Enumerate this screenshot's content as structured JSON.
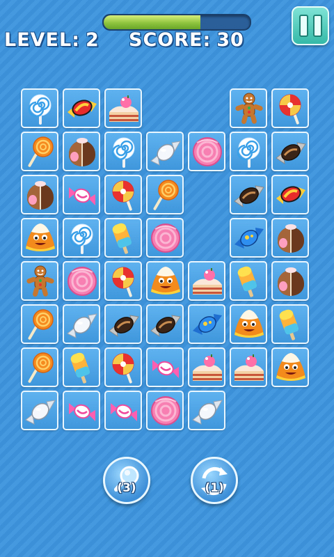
{
  "hud": {
    "level_label": "LEVEL:",
    "level_value": "2",
    "score_label": "SCORE:",
    "score_value": "30",
    "time_progress_fraction": 0.66
  },
  "board": {
    "columns": 7,
    "rows": 8,
    "grid": [
      [
        "swirl-lollipop",
        "wrapped-candy-red",
        "cake-slice",
        null,
        null,
        "gingerbread-man",
        "peppermint-lollipop"
      ],
      [
        "orange-lollipop",
        "chocolate-truffle",
        "swirl-lollipop",
        "wrapped-candy-silver",
        "pink-cupcake",
        "swirl-lollipop",
        "wrapped-candy-chocolate"
      ],
      [
        "chocolate-truffle",
        "wrapped-candy-pink",
        "peppermint-lollipop",
        "orange-lollipop",
        null,
        "wrapped-candy-chocolate",
        "wrapped-candy-red"
      ],
      [
        "candy-corn-monster",
        "swirl-lollipop",
        "ice-pop",
        "pink-cupcake",
        null,
        "wrapped-candy-blue",
        "chocolate-truffle"
      ],
      [
        "gingerbread-man",
        "pink-cupcake",
        "peppermint-lollipop",
        "candy-corn-monster",
        "cake-slice",
        "ice-pop",
        "chocolate-truffle"
      ],
      [
        "orange-lollipop",
        "wrapped-candy-silver",
        "wrapped-candy-chocolate",
        "wrapped-candy-chocolate",
        "wrapped-candy-blue",
        "candy-corn-monster",
        "ice-pop"
      ],
      [
        "orange-lollipop",
        "ice-pop",
        "peppermint-lollipop",
        "wrapped-candy-pink",
        "cake-slice",
        "cake-slice",
        "candy-corn-monster"
      ],
      [
        "wrapped-candy-silver",
        "wrapped-candy-pink",
        "wrapped-candy-pink",
        "pink-cupcake",
        "wrapped-candy-silver",
        null,
        null
      ]
    ]
  },
  "tools": {
    "hint": {
      "icon": "magnifier-icon",
      "count": "(3)"
    },
    "shuffle": {
      "icon": "shuffle-arrows-icon",
      "count": "(1)"
    }
  },
  "colors": {
    "background": "#3d95de",
    "tile": "#4ea6e8",
    "accent": "#35b9a8"
  }
}
